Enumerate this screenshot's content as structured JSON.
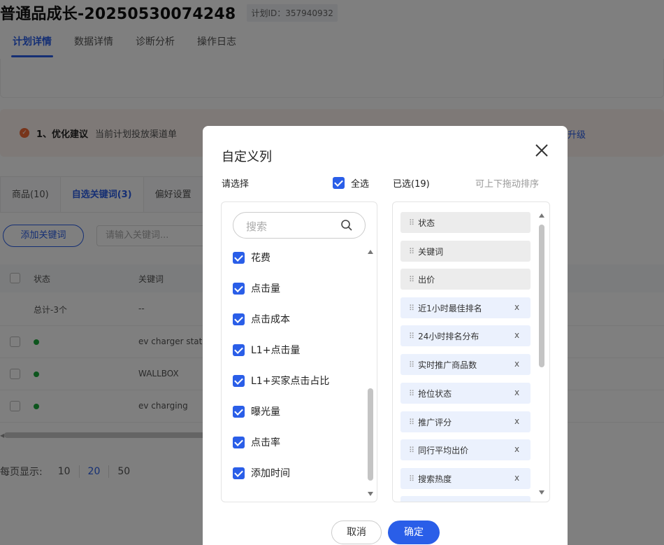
{
  "page": {
    "plan_title": "普通品成长-20250530074248",
    "plan_id": "计划ID：357940932",
    "tabs": [
      "计划详情",
      "数据详情",
      "诊断分析",
      "操作日志"
    ],
    "advice_title": "1、优化建议",
    "advice_text": "当前计划投放渠道单",
    "advice_link": "升级",
    "subtabs": [
      "商品(10)",
      "自选关键词(3)",
      "偏好设置"
    ],
    "add_keyword": "添加关键词",
    "keyword_placeholder": "请输入关键词...",
    "table_headers": [
      "状态",
      "关键词"
    ],
    "total_row": {
      "label": "总计-3个",
      "value": "--"
    },
    "rows": [
      "ev charger stati",
      "WALLBOX",
      "ev charging"
    ],
    "pager_label": "每页显示:",
    "pager_options": [
      "10",
      "20",
      "50"
    ],
    "pager_selected": "20"
  },
  "modal": {
    "title": "自定义列",
    "left_label": "请选择",
    "select_all": "全选",
    "right_label": "已选(19)",
    "drag_hint": "可上下拖动排序",
    "search_placeholder": "搜索",
    "options": [
      "花费",
      "点击量",
      "点击成本",
      "L1+点击量",
      "L1+买家点击占比",
      "曝光量",
      "点击率",
      "添加时间"
    ],
    "selected": [
      {
        "label": "状态",
        "removable": false
      },
      {
        "label": "关键词",
        "removable": false
      },
      {
        "label": "出价",
        "removable": false
      },
      {
        "label": "近1小时最佳排名",
        "removable": true
      },
      {
        "label": "24小时排名分布",
        "removable": true
      },
      {
        "label": "实时推广商品数",
        "removable": true
      },
      {
        "label": "抢位状态",
        "removable": true
      },
      {
        "label": "推广评分",
        "removable": true
      },
      {
        "label": "同行平均出价",
        "removable": true
      },
      {
        "label": "搜索热度",
        "removable": true
      }
    ],
    "remove_glyph": "x",
    "cancel": "取消",
    "ok": "确定"
  },
  "colors": {
    "primary": "#2a5ee8",
    "overlay": "rgba(0,0,0,0.5)"
  }
}
